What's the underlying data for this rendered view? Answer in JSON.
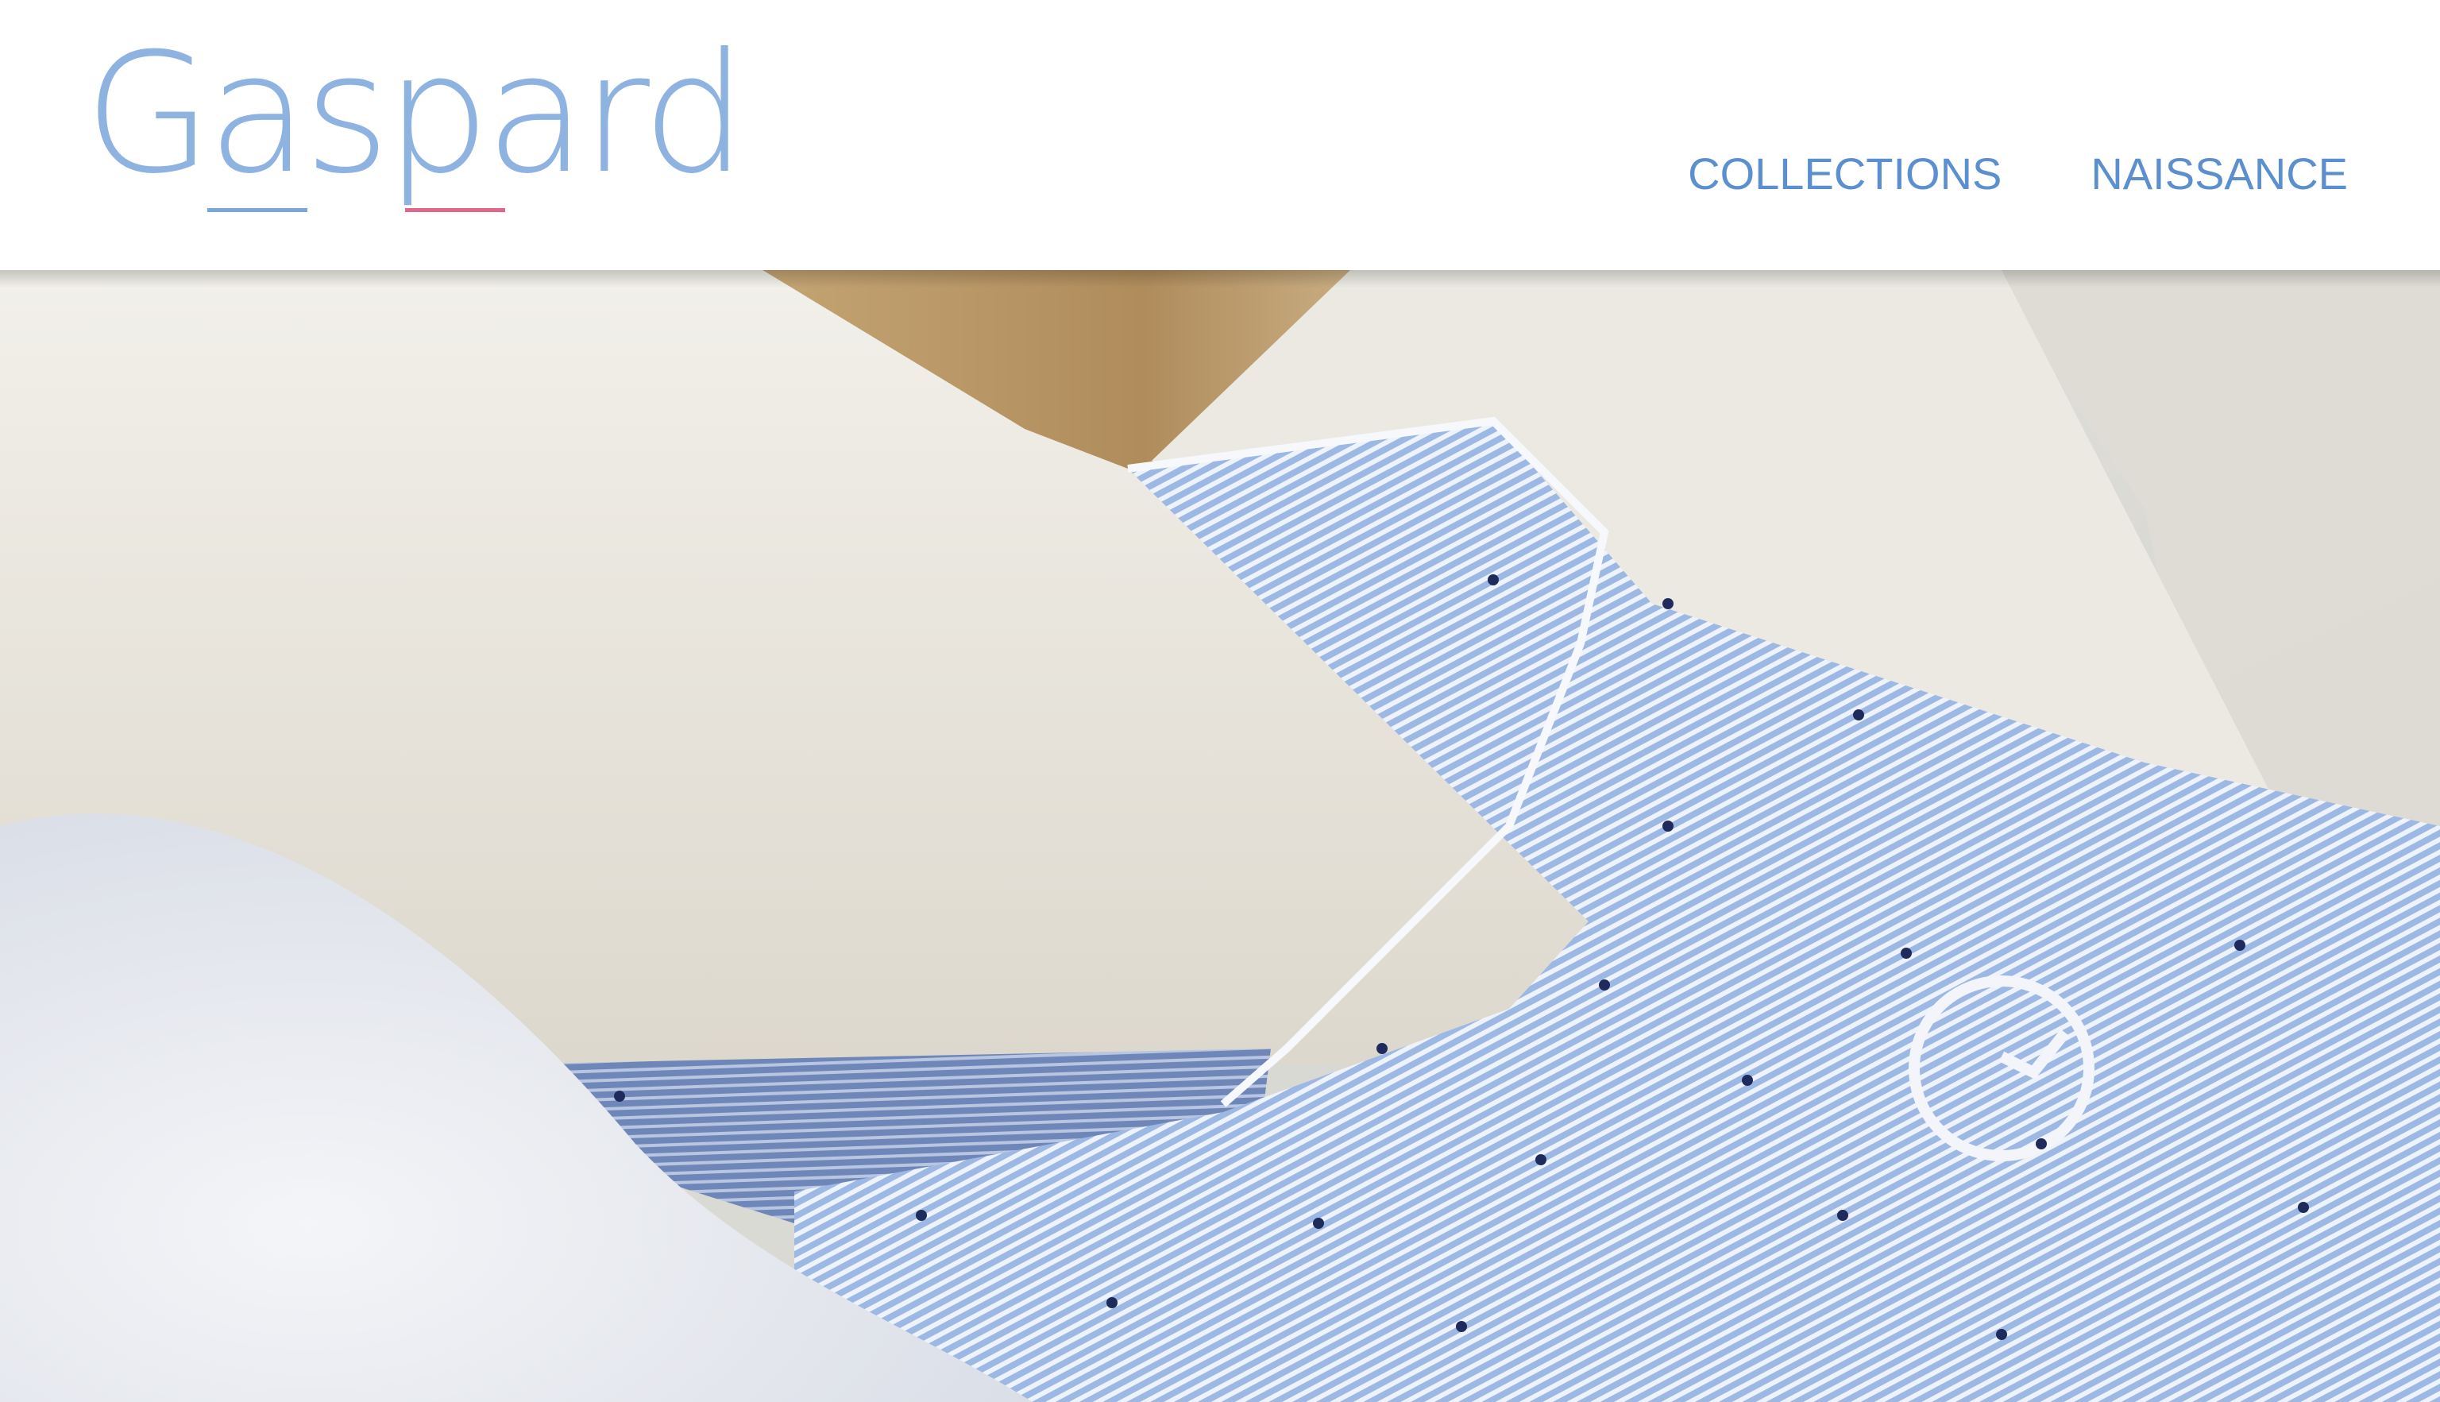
{
  "brand": {
    "name": "Gaspard",
    "colors": {
      "logo": "#8fb3e1",
      "underline_blue": "#7aa8de",
      "underline_pink": "#e0668c",
      "nav": "#5b8fcf"
    }
  },
  "nav": {
    "items": [
      {
        "label": "COLLECTIONS"
      },
      {
        "label": "NAISSANCE"
      }
    ]
  },
  "hero": {
    "subject": "striped-shirt-collar-photo",
    "colors": {
      "wood": "#b99767",
      "hanger": "#ece9e2",
      "shirt_blue": "#a9c1e6",
      "shirt_stripe": "#ffffff",
      "white_fabric": "#e7eaf0",
      "dots": "#1f2b5c"
    }
  }
}
